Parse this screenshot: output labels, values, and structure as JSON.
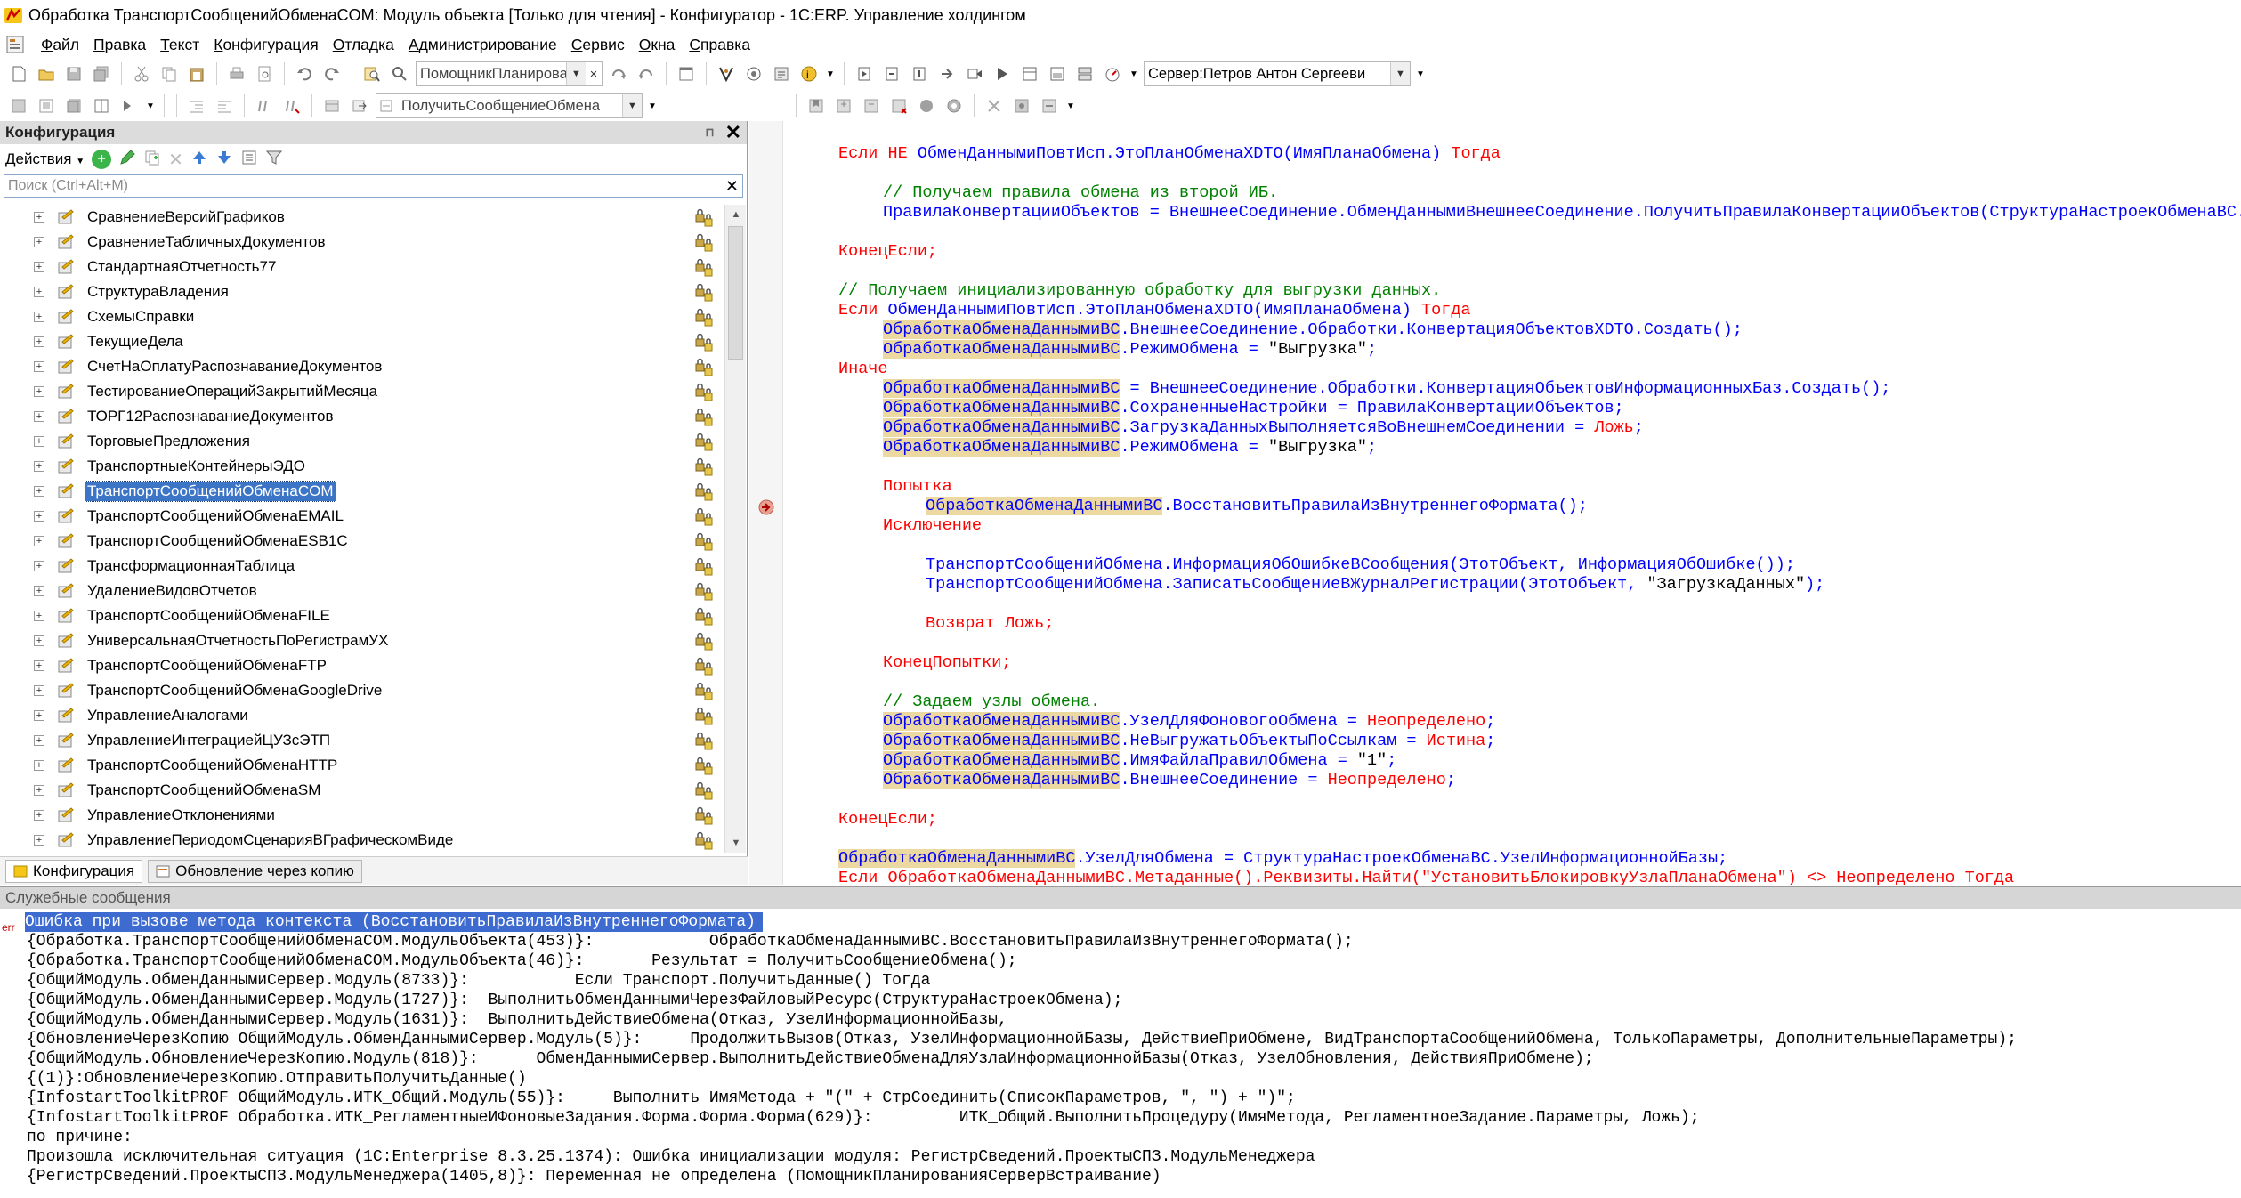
{
  "window": {
    "title": "Обработка ТранспортСообщенийОбменаCOM: Модуль объекта [Только для чтения] - Конфигуратор - 1С:ERP. Управление холдингом"
  },
  "menu": [
    "Файл",
    "Правка",
    "Текст",
    "Конфигурация",
    "Отладка",
    "Администрирование",
    "Сервис",
    "Окна",
    "Справка"
  ],
  "toolbar": {
    "search_combo": "ПомощникПланирова",
    "server_combo": "Сервер:Петров Антон Сергееви",
    "method_combo": "ПолучитьСообщениеОбмена"
  },
  "config_panel": {
    "title": "Конфигурация",
    "actions_label": "Действия",
    "search_placeholder": "Поиск (Ctrl+Alt+M)",
    "items": [
      "СравнениеВерсийГрафиков",
      "СравнениеТабличныхДокументов",
      "СтандартнаяОтчетность77",
      "СтруктураВладения",
      "СхемыСправки",
      "ТекущиеДела",
      "СчетНаОплатуРаспознаваниеДокументов",
      "ТестированиеОперацийЗакрытийМесяца",
      "ТОРГ12РаспознаваниеДокументов",
      "ТорговыеПредложения",
      "ТранспортныеКонтейнерыЭДО",
      "ТранспортСообщенийОбменаCOM",
      "ТранспортСообщенийОбменаEMAIL",
      "ТранспортСообщенийОбменаESB1C",
      "ТрансформационнаяТаблица",
      "УдалениеВидовОтчетов",
      "ТранспортСообщенийОбменаFILE",
      "УниверсальнаяОтчетностьПоРегистрамУХ",
      "ТранспортСообщенийОбменаFTP",
      "ТранспортСообщенийОбменаGoogleDrive",
      "УправлениеАналогами",
      "УправлениеИнтеграциейЦУЗсЭТП",
      "ТранспортСообщенийОбменаHTTP",
      "ТранспортСообщенийОбменаSM",
      "УправлениеОтклонениями",
      "УправлениеПериодомСценарияВГрафическомВиде"
    ],
    "selected_index": 11,
    "tab_config": "Конфигурация",
    "tab_update": "Обновление через копию"
  },
  "code": {
    "l1": {
      "a": "Если НЕ ",
      "b": "ОбменДаннымиПовтИсп.ЭтоПланОбменаXDTO(ИмяПланаОбмена)",
      "c": " Тогда"
    },
    "l2": "// Получаем правила обмена из второй ИБ.",
    "l3": "ПравилаКонвертацииОбъектов = ВнешнееСоединение.ОбменДаннымиВнешнееСоединение.ПолучитьПравилаКонвертацииОбъектов(СтруктураНастроекОбменаВС.ИмяПланаОбмена);",
    "l4": "КонецЕсли;",
    "l5": "// Получаем инициализированную обработку для выгрузки данных.",
    "l6": {
      "a": "Если ",
      "b": "ОбменДаннымиПовтИсп.ЭтоПланОбменаXDTO(ИмяПланаОбмена)",
      "c": " Тогда"
    },
    "hlvar": "ОбработкаОбменаДаннымиВС",
    "l7": ".ВнешнееСоединение.Обработки.КонвертацияОбъектовXDTO.Создать();",
    "l8": ".РежимОбмена = ",
    "l8s": "\"Выгрузка\"",
    "l8e": ";",
    "l9": "Иначе",
    "l10": " = ВнешнееСоединение.Обработки.КонвертацияОбъектовИнформационныхБаз.Создать();",
    "l11": ".СохраненныеНастройки = ПравилаКонвертацииОбъектов;",
    "l12": ".ЗагрузкаДанныхВыполняетсяВоВнешнемСоединении = ",
    "l12k": "Ложь",
    "l12e": ";",
    "l13": ".РежимОбмена = ",
    "l13s": "\"Выгрузка\"",
    "l13e": ";",
    "l14": "Попытка",
    "l15": ".ВосстановитьПравилаИзВнутреннегоФормата();",
    "l16": "Исключение",
    "l17": "ТранспортСообщенийОбмена.ИнформацияОбОшибкеВСообщения(ЭтотОбъект, ИнформацияОбОшибке());",
    "l18": "ТранспортСообщенийОбмена.ЗаписатьСообщениеВЖурналРегистрации(ЭтотОбъект, ",
    "l18s": "\"ЗагрузкаДанных\"",
    "l18e": ");",
    "l19": "Возврат Ложь;",
    "l20": "КонецПопытки;",
    "l21": "// Задаем узлы обмена.",
    "l22": ".УзелДляФоновогоОбмена = ",
    "l22k": "Неопределено",
    "l22e": ";",
    "l23": ".НеВыгружатьОбъектыПоСсылкам = ",
    "l23k": "Истина",
    "l23e": ";",
    "l24": ".ИмяФайлаПравилОбмена = ",
    "l24s": "\"1\"",
    "l24e": ";",
    "l25": ".ВнешнееСоединение = ",
    "l25k": "Неопределено",
    "l25e": ";",
    "l26": "КонецЕсли;",
    "l27": ".УзелДляОбмена = СтруктураНастроекОбменаВС.УзелИнформационнойБазы;",
    "l28": "Если ОбработкаОбменаДаннымиВС.Метаданные().Реквизиты.Найти(\"УстановитьБлокировкуУзлаПланаОбмена\") <> Неопределено Тогда"
  },
  "messages": {
    "title": "Служебные сообщения",
    "badge": "err",
    "lines": [
      "Ошибка при вызове метода контекста (ВосстановитьПравилаИзВнутреннегоФормата)",
      "{Обработка.ТранспортСообщенийОбменаCOM.МодульОбъекта(453)}:            ОбработкаОбменаДаннымиВС.ВосстановитьПравилаИзВнутреннегоФормата();",
      "{Обработка.ТранспортСообщенийОбменаCOM.МодульОбъекта(46)}:       Результат = ПолучитьСообщениеОбмена();",
      "{ОбщийМодуль.ОбменДаннымиСервер.Модуль(8733)}:           Если Транспорт.ПолучитьДанные() Тогда",
      "{ОбщийМодуль.ОбменДаннымиСервер.Модуль(1727)}:  ВыполнитьОбменДаннымиЧерезФайловыйРесурс(СтруктураНастроекОбмена);",
      "{ОбщийМодуль.ОбменДаннымиСервер.Модуль(1631)}:  ВыполнитьДействиеОбмена(Отказ, УзелИнформационнойБазы,",
      "{ОбновлениеЧерезКопию ОбщийМодуль.ОбменДаннымиСервер.Модуль(5)}:     ПродолжитьВызов(Отказ, УзелИнформационнойБазы, ДействиеПриОбмене, ВидТранспортаСообщенийОбмена, ТолькоПараметры, ДополнительныеПараметры);",
      "{ОбщийМодуль.ОбновлениеЧерезКопию.Модуль(818)}:      ОбменДаннымиСервер.ВыполнитьДействиеОбменаДляУзлаИнформационнойБазы(Отказ, УзелОбновления, ДействияПриОбмене);",
      "{(1)}:ОбновлениеЧерезКопию.ОтправитьПолучитьДанные()",
      "{InfostartToolkitPROF ОбщийМодуль.ИТК_Общий.Модуль(55)}:     Выполнить ИмяМетода + \"(\" + СтрСоединить(СписокПараметров, \", \") + \")\";",
      "{InfostartToolkitPROF Обработка.ИТК_РегламентныеИФоновыеЗадания.Форма.Форма.Форма(629)}:         ИТК_Общий.ВыполнитьПроцедуру(ИмяМетода, РегламентноеЗадание.Параметры, Ложь);",
      "по причине:",
      "Произошла исключительная ситуация (1C:Enterprise 8.3.25.1374): Ошибка инициализации модуля: РегистрСведений.ПроектыСПЗ.МодульМенеджера",
      "{РегистрСведений.ПроектыСПЗ.МодульМенеджера(1405,8)}: Переменная не определена (ПомощникПланированияСерверВстраивание)"
    ]
  }
}
